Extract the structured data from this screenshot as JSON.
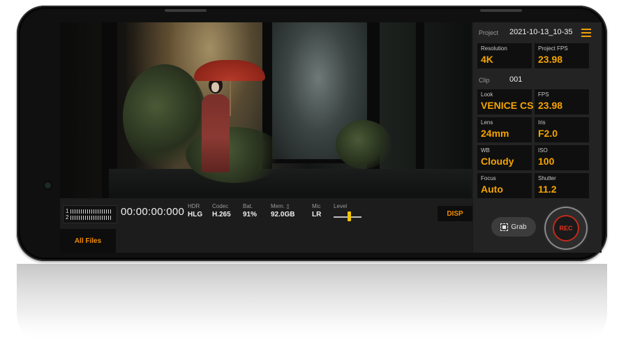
{
  "project": {
    "label": "Project",
    "value": "2021-10-13_10-35"
  },
  "settings_top": [
    {
      "label": "Resolution",
      "value": "4K"
    },
    {
      "label": "Project FPS",
      "value": "23.98"
    }
  ],
  "clip": {
    "label": "Clip",
    "value": "001"
  },
  "settings_grid": [
    {
      "label": "Look",
      "value": "VENICE CS"
    },
    {
      "label": "FPS",
      "value": "23.98"
    },
    {
      "label": "Lens",
      "value": "24mm"
    },
    {
      "label": "Iris",
      "value": "F2.0"
    },
    {
      "label": "WB",
      "value": "Cloudy"
    },
    {
      "label": "ISO",
      "value": "100"
    },
    {
      "label": "Focus",
      "value": "Auto"
    },
    {
      "label": "Shutter",
      "value": "11.2"
    }
  ],
  "status_bar": {
    "meter_channels": [
      "1",
      "2"
    ],
    "timecode": "00:00:00:000",
    "stats": [
      {
        "label": "HDR",
        "value": "HLG"
      },
      {
        "label": "Codec",
        "value": "H.265"
      },
      {
        "label": "Bat.",
        "value": "91%"
      },
      {
        "label": "Mem. ▯",
        "value": "92.0GB"
      },
      {
        "label": "Mic",
        "value": "LR"
      }
    ],
    "level_label": "Level",
    "level_value": 0.55
  },
  "buttons": {
    "disp": "DISP",
    "all_files": "All Files",
    "grab": "Grab",
    "rec": "REC"
  },
  "icons": {
    "menu": "hamburger-menu-icon",
    "grab": "grab-frame-icon"
  },
  "colors": {
    "accent_orange": "#f5a400",
    "rec_red": "#e2321f",
    "panel_bg": "#232323",
    "cell_bg": "#0f0f0f"
  }
}
